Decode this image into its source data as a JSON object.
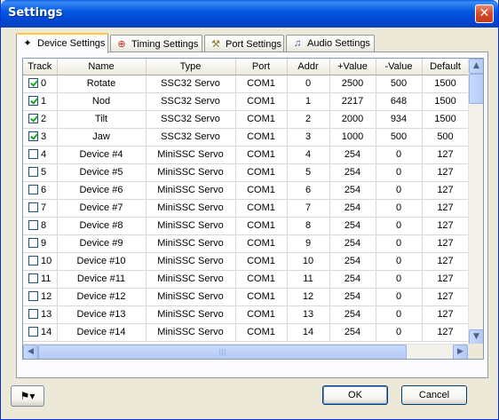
{
  "window": {
    "title": "Settings",
    "close_label": "✕"
  },
  "tabs": [
    {
      "label": "Device Settings",
      "icon": "device-icon",
      "glyph": "✦",
      "active": true
    },
    {
      "label": "Timing Settings",
      "icon": "timing-icon",
      "glyph": "⊕",
      "active": false
    },
    {
      "label": "Port Settings",
      "icon": "port-icon",
      "glyph": "⚒",
      "active": false
    },
    {
      "label": "Audio Settings",
      "icon": "audio-icon",
      "glyph": "♫",
      "active": false
    }
  ],
  "columns": [
    "Track",
    "Name",
    "Type",
    "Port",
    "Addr",
    "+Value",
    "-Value",
    "Default"
  ],
  "rows": [
    {
      "checked": true,
      "track": "0",
      "name": "Rotate",
      "type": "SSC32 Servo",
      "port": "COM1",
      "addr": "0",
      "pos": "2500",
      "neg": "500",
      "def": "1500"
    },
    {
      "checked": true,
      "track": "1",
      "name": "Nod",
      "type": "SSC32 Servo",
      "port": "COM1",
      "addr": "1",
      "pos": "2217",
      "neg": "648",
      "def": "1500"
    },
    {
      "checked": true,
      "track": "2",
      "name": "Tilt",
      "type": "SSC32 Servo",
      "port": "COM1",
      "addr": "2",
      "pos": "2000",
      "neg": "934",
      "def": "1500"
    },
    {
      "checked": true,
      "track": "3",
      "name": "Jaw",
      "type": "SSC32 Servo",
      "port": "COM1",
      "addr": "3",
      "pos": "1000",
      "neg": "500",
      "def": "500"
    },
    {
      "checked": false,
      "track": "4",
      "name": "Device #4",
      "type": "MiniSSC Servo",
      "port": "COM1",
      "addr": "4",
      "pos": "254",
      "neg": "0",
      "def": "127"
    },
    {
      "checked": false,
      "track": "5",
      "name": "Device #5",
      "type": "MiniSSC Servo",
      "port": "COM1",
      "addr": "5",
      "pos": "254",
      "neg": "0",
      "def": "127"
    },
    {
      "checked": false,
      "track": "6",
      "name": "Device #6",
      "type": "MiniSSC Servo",
      "port": "COM1",
      "addr": "6",
      "pos": "254",
      "neg": "0",
      "def": "127"
    },
    {
      "checked": false,
      "track": "7",
      "name": "Device #7",
      "type": "MiniSSC Servo",
      "port": "COM1",
      "addr": "7",
      "pos": "254",
      "neg": "0",
      "def": "127"
    },
    {
      "checked": false,
      "track": "8",
      "name": "Device #8",
      "type": "MiniSSC Servo",
      "port": "COM1",
      "addr": "8",
      "pos": "254",
      "neg": "0",
      "def": "127"
    },
    {
      "checked": false,
      "track": "9",
      "name": "Device #9",
      "type": "MiniSSC Servo",
      "port": "COM1",
      "addr": "9",
      "pos": "254",
      "neg": "0",
      "def": "127"
    },
    {
      "checked": false,
      "track": "10",
      "name": "Device #10",
      "type": "MiniSSC Servo",
      "port": "COM1",
      "addr": "10",
      "pos": "254",
      "neg": "0",
      "def": "127"
    },
    {
      "checked": false,
      "track": "11",
      "name": "Device #11",
      "type": "MiniSSC Servo",
      "port": "COM1",
      "addr": "11",
      "pos": "254",
      "neg": "0",
      "def": "127"
    },
    {
      "checked": false,
      "track": "12",
      "name": "Device #12",
      "type": "MiniSSC Servo",
      "port": "COM1",
      "addr": "12",
      "pos": "254",
      "neg": "0",
      "def": "127"
    },
    {
      "checked": false,
      "track": "13",
      "name": "Device #13",
      "type": "MiniSSC Servo",
      "port": "COM1",
      "addr": "13",
      "pos": "254",
      "neg": "0",
      "def": "127"
    },
    {
      "checked": false,
      "track": "14",
      "name": "Device #14",
      "type": "MiniSSC Servo",
      "port": "COM1",
      "addr": "14",
      "pos": "254",
      "neg": "0",
      "def": "127"
    }
  ],
  "scrollbars": {
    "up": "▲",
    "down": "▼",
    "left": "◀",
    "right": "▶",
    "grip": "|||"
  },
  "footer": {
    "tool_icon": "tool-icon",
    "tool_glyph": "⚑▾",
    "ok_label": "OK",
    "cancel_label": "Cancel"
  },
  "colors": {
    "titlebar": "#0a54e0",
    "tab_highlight": "#ffc83c",
    "checkmark": "#21a121"
  }
}
